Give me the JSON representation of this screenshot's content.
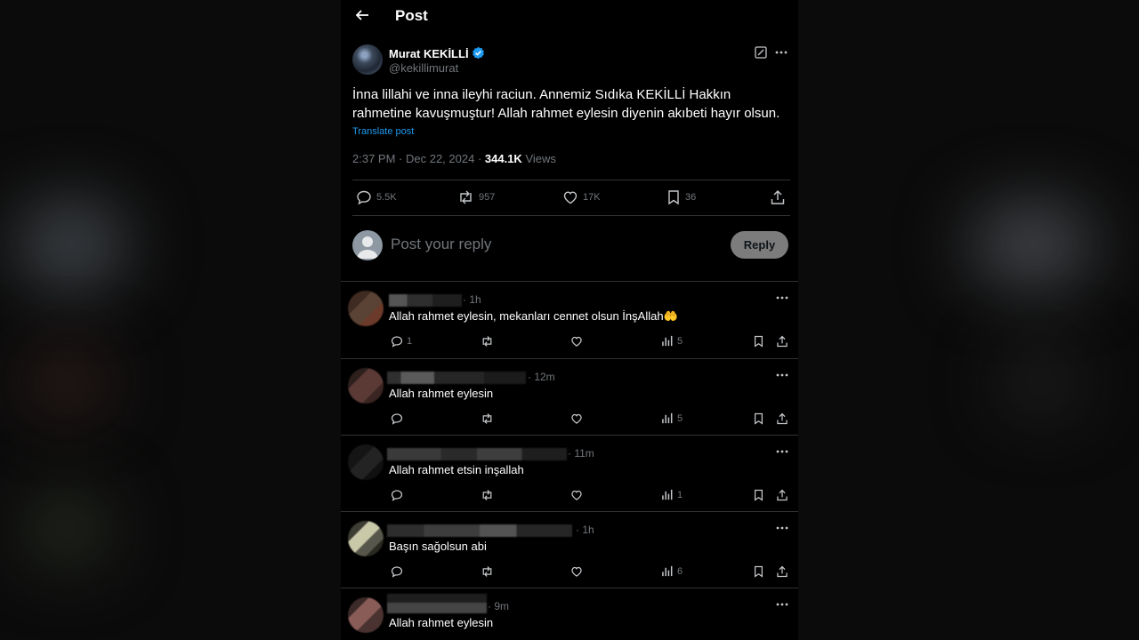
{
  "header": {
    "title": "Post"
  },
  "post": {
    "author_name": "Murat KEKİLLİ",
    "author_handle": "@kekillimurat",
    "text": "İnna lillahi ve inna ileyhi raciun. Annemiz Sıdıka KEKİLLİ Hakkın rahmetine kavuşmuştur! Allah rahmet eylesin diyenin akıbeti hayır olsun.",
    "translate_label": "Translate post",
    "time": "2:37 PM",
    "date": "Dec 22, 2024",
    "views_count": "344.1K",
    "views_label": "Views",
    "stats": {
      "replies": "5.5K",
      "reposts": "957",
      "likes": "17K",
      "bookmarks": "36"
    }
  },
  "reply_box": {
    "placeholder": "Post your reply",
    "button_label": "Reply"
  },
  "comments": [
    {
      "time": "· 1h",
      "text": "Allah rahmet eylesin, mekanları cennet olsun İnşAllah🤲",
      "replies": "1",
      "views": "5"
    },
    {
      "time": "· 12m",
      "text": "Allah rahmet eylesin",
      "replies": "",
      "views": "5"
    },
    {
      "time": "· 11m",
      "text": "Allah rahmet etsin inşallah",
      "replies": "",
      "views": "1"
    },
    {
      "time": "· 1h",
      "text": "Başın sağolsun abi",
      "replies": "",
      "views": "6"
    },
    {
      "time": "· 9m",
      "text": "Allah rahmet eylesin",
      "replies": "",
      "views": ""
    }
  ],
  "colors": {
    "accent": "#1d9bf0",
    "muted": "#71767b",
    "divider": "#2f3336"
  }
}
